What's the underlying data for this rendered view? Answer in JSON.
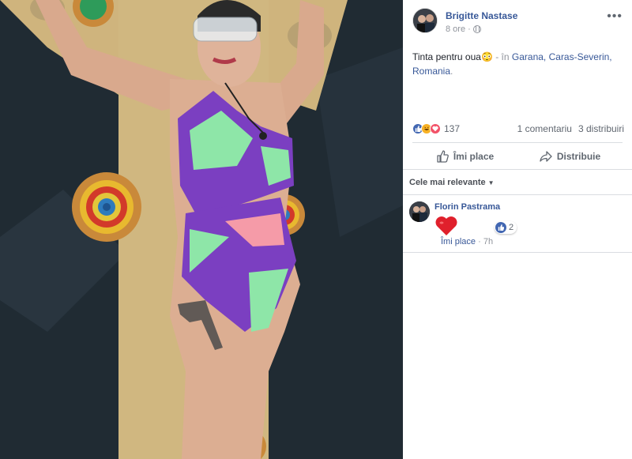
{
  "post": {
    "author": "Brigitte Nastase",
    "time": "8 ore",
    "more": "•••",
    "text_main": "Tinta pentru oua😳",
    "text_loc": " - în ",
    "loc_link_1": "Garana, Caras-Severin,",
    "loc_link_2": "Romania",
    "loc_end": "."
  },
  "reactions": {
    "count": "137",
    "comments": "1 comentariu",
    "shares": "3 distribuiri",
    "icons": [
      "like-icon",
      "haha-icon",
      "love-icon"
    ],
    "colors": {
      "like": "#4267b2",
      "haha": "#f7b125",
      "love": "#f25268"
    }
  },
  "actions": {
    "like_label": "Îmi place",
    "share_label": "Distribuie"
  },
  "comments": {
    "sort_label": "Cele mai relevante",
    "items": [
      {
        "name": "Florin Pastrama",
        "likes": "2",
        "like_link": "Îmi place",
        "time": "7h"
      }
    ]
  },
  "colors": {
    "link": "#385898",
    "secondary": "#90949c",
    "divider": "#dadde1"
  }
}
